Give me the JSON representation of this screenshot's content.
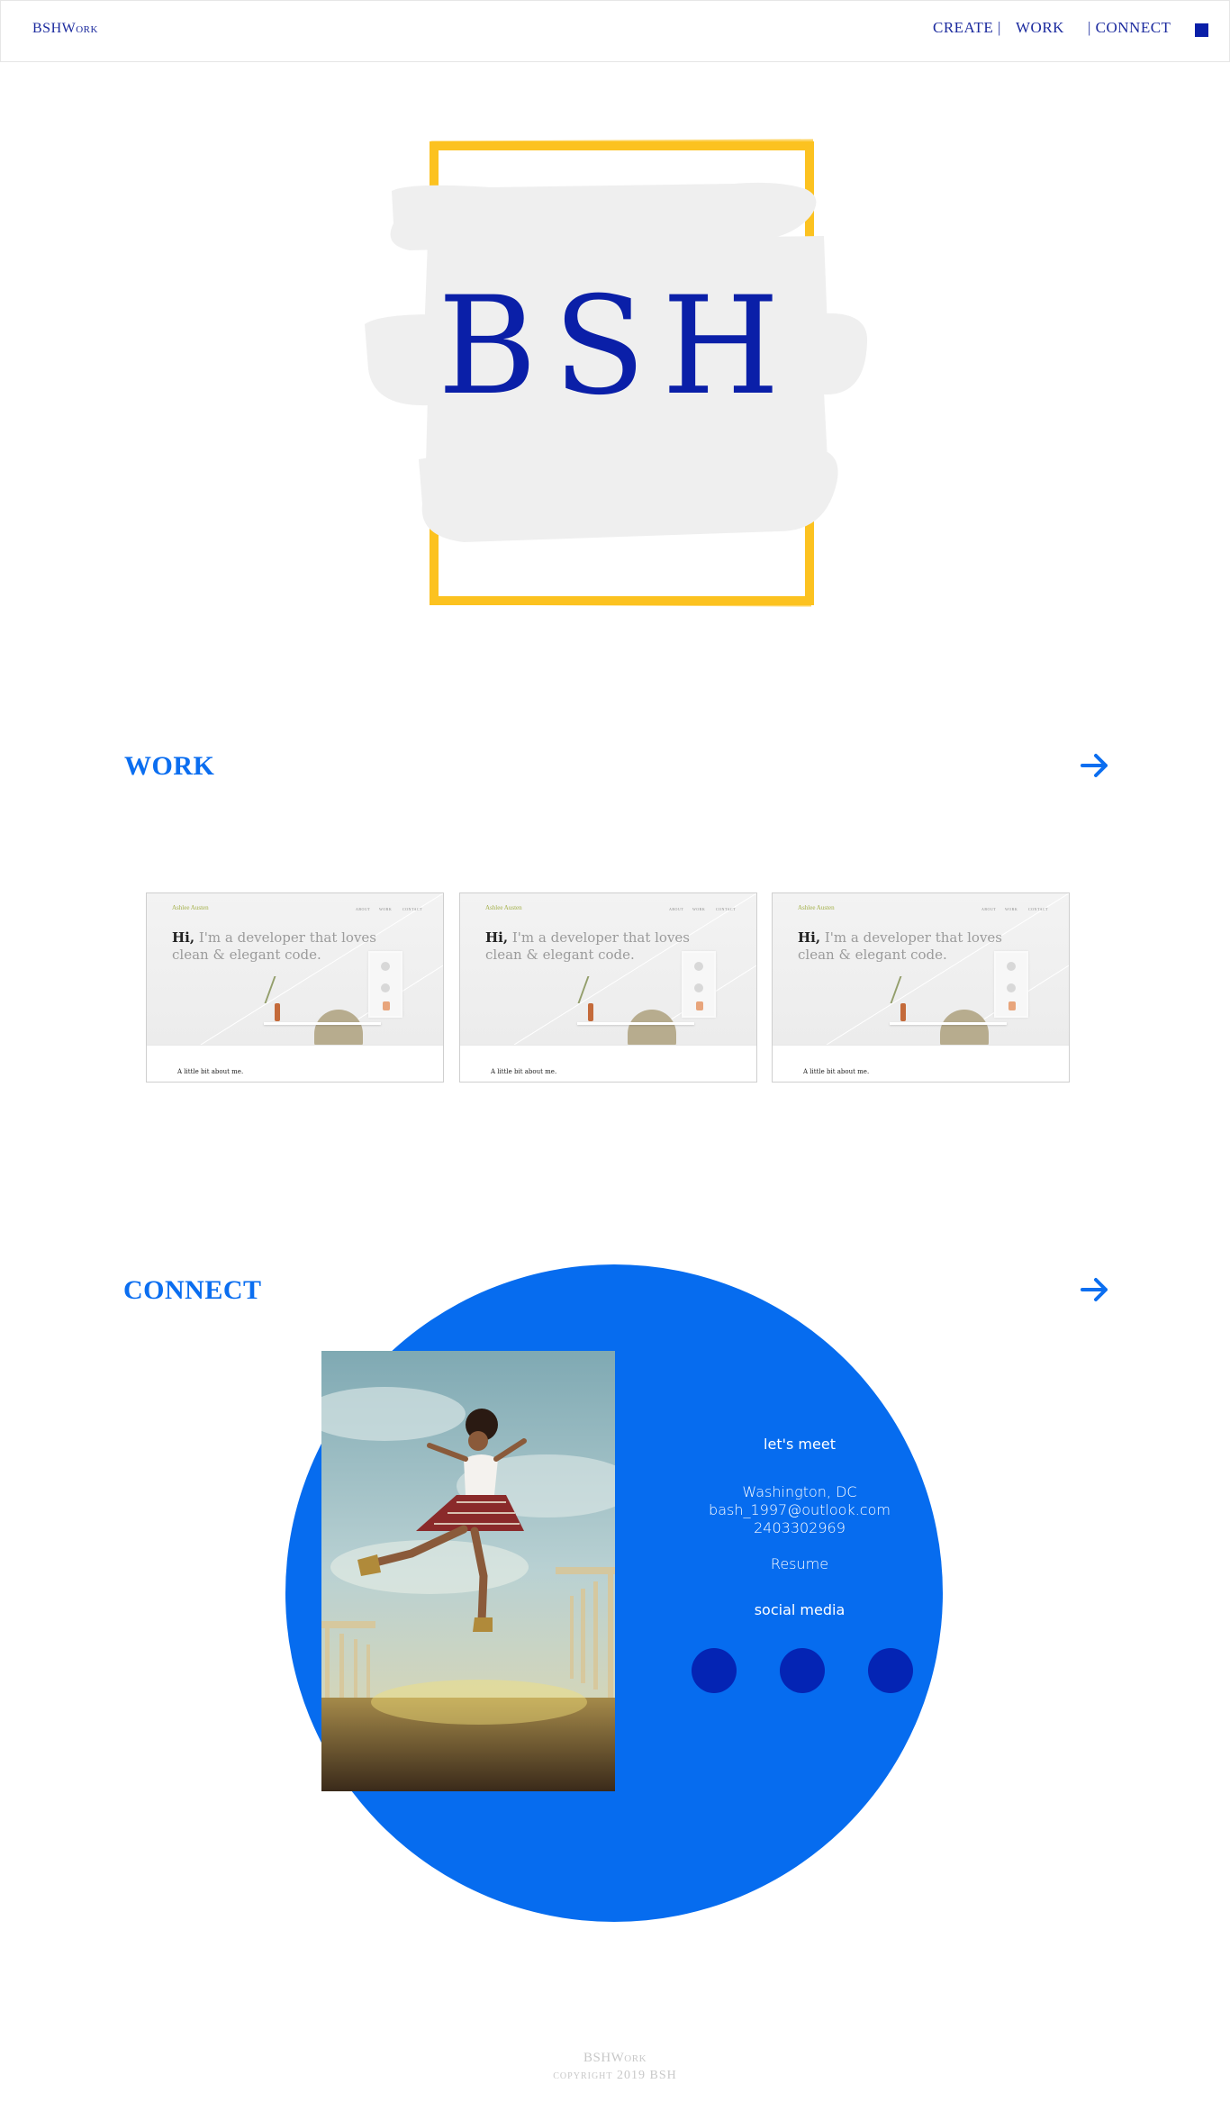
{
  "header": {
    "brand": "BSHWork",
    "nav": [
      {
        "label": "CREATE |"
      },
      {
        "label": "WORK"
      },
      {
        "label": "| CONNECT"
      }
    ],
    "menu_icon": "square-menu-icon"
  },
  "hero": {
    "logo_text": "BSH",
    "colors": {
      "frame": "#fcc220",
      "paint": "#efefef",
      "text": "#0a1fa8"
    }
  },
  "work": {
    "title": "WORK",
    "arrow_icon": "arrow-right-icon",
    "cards": [
      {
        "brand": "Ashlee Austen",
        "nav": [
          "ABOUT",
          "WORK",
          "CONTACT"
        ],
        "headline_bold": "Hi,",
        "headline": " I'm a developer that loves clean & elegant code.",
        "about": "A little bit about me."
      },
      {
        "brand": "Ashlee Austen",
        "nav": [
          "ABOUT",
          "WORK",
          "CONTACT"
        ],
        "headline_bold": "Hi,",
        "headline": " I'm a developer that loves clean & elegant code.",
        "about": "A little bit about me."
      },
      {
        "brand": "Ashlee Austen",
        "nav": [
          "ABOUT",
          "WORK",
          "CONTACT"
        ],
        "headline_bold": "Hi,",
        "headline": " I'm a developer that loves clean & elegant code.",
        "about": "A little bit about me."
      }
    ]
  },
  "connect": {
    "title": "CONNECT",
    "arrow_icon": "arrow-right-icon",
    "lets_meet": "let's meet",
    "city": "Washington, DC",
    "email": "bash_1997@outlook.com",
    "phone": "2403302969",
    "resume": "Resume",
    "social_heading": "social media",
    "colors": {
      "circle": "#066cef",
      "social": "#0424b4"
    }
  },
  "footer": {
    "brand": "BSHWork",
    "copyright": "copyright 2019 BSH"
  }
}
